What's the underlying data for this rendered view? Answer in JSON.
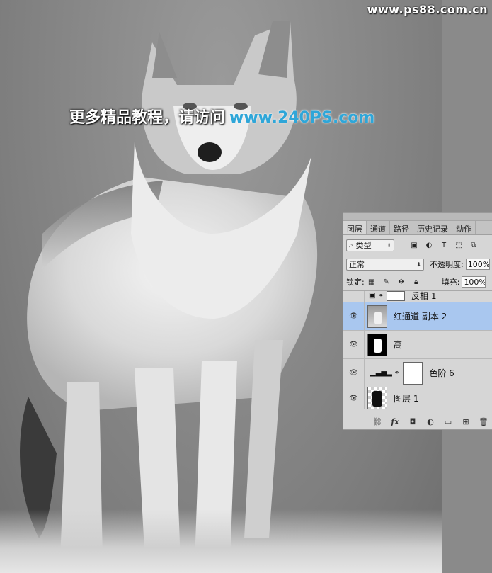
{
  "canvas": {
    "watermark": "www.ps88.com.cn",
    "promo_text": "更多精品教程，请访问",
    "promo_url": "www.240PS.com"
  },
  "layers_panel": {
    "tabs": [
      "图层",
      "通道",
      "路径",
      "历史记录",
      "动作"
    ],
    "active_tab": "图层",
    "filter_label": "类型",
    "blend_mode": "正常",
    "opacity_label": "不透明度:",
    "opacity_value": "100%",
    "lock_label": "锁定:",
    "fill_label": "填充:",
    "fill_value": "100%",
    "layers": [
      {
        "name": "反相 1",
        "visible": false,
        "partial": true
      },
      {
        "name": "红通道 副本 2",
        "visible": true,
        "selected": true
      },
      {
        "name": "高",
        "visible": true
      },
      {
        "name": "色阶 6",
        "visible": true,
        "adjustment": true
      },
      {
        "name": "图层 1",
        "visible": true,
        "partial": true
      }
    ]
  },
  "colors": {
    "accent_url": "#2fa6d8",
    "selected_layer": "#a9c7ef",
    "panel_bg": "#d6d6d6"
  }
}
